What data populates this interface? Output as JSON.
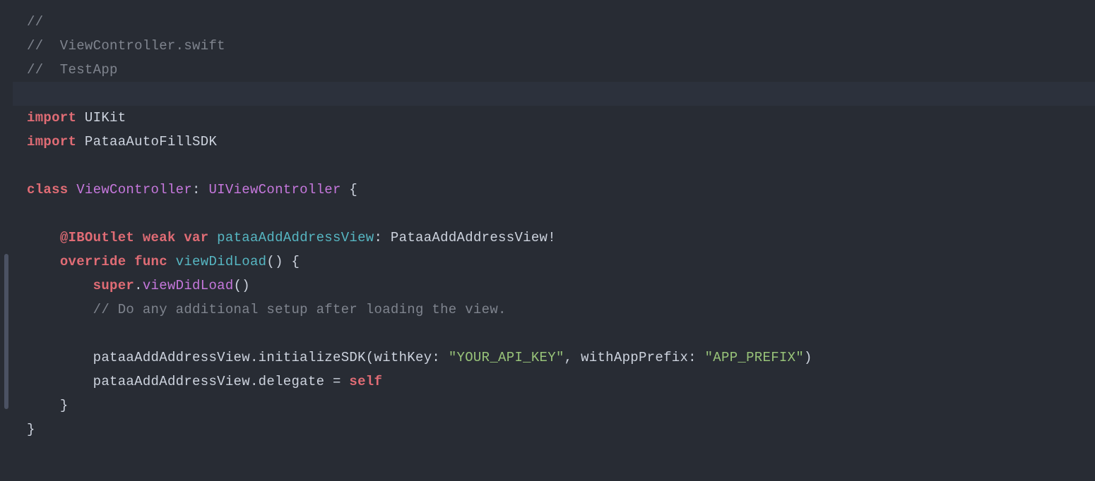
{
  "code": {
    "c1": "//",
    "c2": "//  ViewController.swift",
    "c3": "//  TestApp",
    "import_kw": "import",
    "uikit": "UIKit",
    "sdk_import": "PataaAutoFillSDK",
    "class_kw": "class",
    "class_name": "ViewController",
    "colon": ":",
    "super_class": "UIViewController",
    "brace_open": " {",
    "iboutlet": "@IBOutlet",
    "weak": "weak",
    "var_kw": "var",
    "prop_name": "pataaAddAddressView",
    "prop_type": "PataaAddAddressView!",
    "override": "override",
    "func_kw": "func",
    "viewdidload": "viewDidLoad",
    "parens": "()",
    "brace2": " {",
    "super_kw": "super",
    "dot": ".",
    "vdl_call": "viewDidLoad",
    "comment_setup": "// Do any additional setup after loading the view.",
    "init_sdk": "initializeSDK",
    "withkey": "withKey:",
    "api_key_str": "\"YOUR_API_KEY\"",
    "comma": ", ",
    "withprefix": "withAppPrefix:",
    "prefix_str": "\"APP_PREFIX\"",
    "delegate": "delegate",
    "equals": " = ",
    "self_kw": "self",
    "brace_close": "}",
    "paren_open": "(",
    "paren_close": ")"
  }
}
